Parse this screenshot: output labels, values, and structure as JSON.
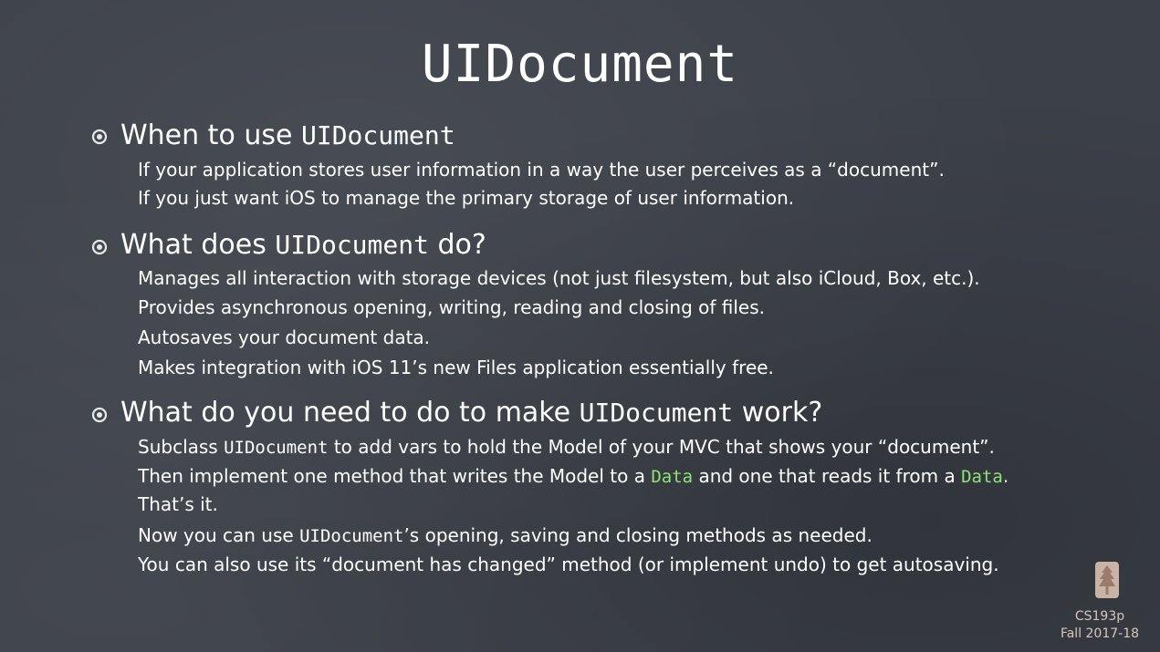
{
  "title": "UIDocument",
  "sections": [
    {
      "heading_pre": "When to use ",
      "heading_code": "UIDocument",
      "heading_post": "",
      "lines": [
        "If your application stores user information in a way the user perceives as a “document”.",
        "If you just want iOS to manage the primary storage of user information."
      ]
    },
    {
      "heading_pre": "What does ",
      "heading_code": "UIDocument",
      "heading_post": " do?",
      "lines": [
        "Manages all interaction with storage devices (not just filesystem, but also iCloud, Box, etc.).",
        "Provides asynchronous opening, writing, reading and closing of files.",
        "Autosaves your document data.",
        "Makes integration with iOS 11’s new Files application essentially free."
      ]
    },
    {
      "heading_pre": "What do you need to do to make ",
      "heading_code": "UIDocument",
      "heading_post": " work?",
      "line1": {
        "pre": "Subclass ",
        "code": "UIDocument",
        "post": " to add vars to hold the Model of your MVC that shows your “document”."
      },
      "line2": {
        "pre": "Then implement one method that writes the Model to a ",
        "code1": "Data",
        "mid": " and one that reads it from a ",
        "code2": "Data",
        "post": "."
      },
      "line3": "That’s it.",
      "line4": {
        "pre": "Now you can use ",
        "code": "UIDocument",
        "post": "’s opening, saving and closing methods as needed."
      },
      "line5": "You can also use its “document has changed” method (or implement undo) to get autosaving."
    }
  ],
  "footer": {
    "course": "CS193p",
    "term": "Fall 2017-18",
    "logo_icon": "stanford-tree-logo"
  },
  "colors": {
    "background": "#3c4048",
    "text": "#ffffff",
    "code_highlight": "#8fe27a",
    "footer_text": "#d6c6bd"
  }
}
